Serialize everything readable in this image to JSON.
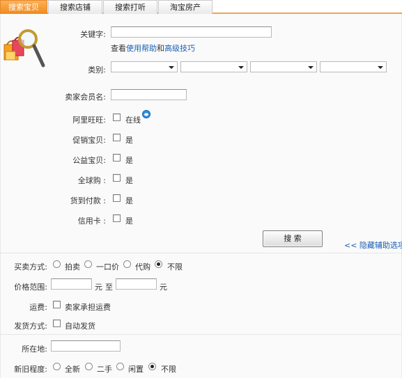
{
  "tabs": [
    {
      "label": "搜索宝贝",
      "active": true
    },
    {
      "label": "搜索店铺",
      "active": false
    },
    {
      "label": "搜索打听",
      "active": false
    },
    {
      "label": "淘宝房产",
      "active": false
    }
  ],
  "keyword": {
    "label": "关键字:",
    "value": "",
    "help_prefix": "查看",
    "help_link": "使用帮助",
    "help_and": "和",
    "tips_link": "高级技巧"
  },
  "category": {
    "label": "类别:",
    "selects": [
      "",
      "",
      "",
      ""
    ]
  },
  "seller": {
    "label": "卖家会员名:",
    "value": ""
  },
  "options": [
    {
      "label": "阿里旺旺:",
      "text": "在线",
      "checked": false
    },
    {
      "label": "促销宝贝:",
      "text": "是",
      "checked": false
    },
    {
      "label": "公益宝贝:",
      "text": "是",
      "checked": false
    },
    {
      "label": "全球购 :",
      "text": "是",
      "checked": false
    },
    {
      "label": "货到付款 :",
      "text": "是",
      "checked": false
    },
    {
      "label": "信用卡 :",
      "text": "是",
      "checked": false
    }
  ],
  "search_button": "搜 索",
  "hide_link": "<< 隐藏辅助选项",
  "trade_mode": {
    "label": "买卖方式:",
    "options": [
      "拍卖",
      "一口价",
      "代购",
      "不限"
    ],
    "selected": "不限"
  },
  "price": {
    "label": "价格范围:",
    "unit": "元",
    "to": "至",
    "min": "",
    "max": ""
  },
  "shipping": {
    "label": "运费:",
    "text": "卖家承担运费",
    "checked": false
  },
  "delivery": {
    "label": "发货方式:",
    "text": "自动发货",
    "checked": false
  },
  "location": {
    "label": "所在地:",
    "value": ""
  },
  "condition": {
    "label": "新旧程度:",
    "options": [
      "全新",
      "二手",
      "闲置",
      "不限"
    ],
    "selected": "不限"
  },
  "colors": {
    "tab_active": "#f08a1c",
    "link": "#1a5fb4",
    "accent_border": "#f3a44a"
  },
  "icons": [
    "shopping-bags-icon",
    "magnifier-icon",
    "wangwang-online-icon"
  ]
}
